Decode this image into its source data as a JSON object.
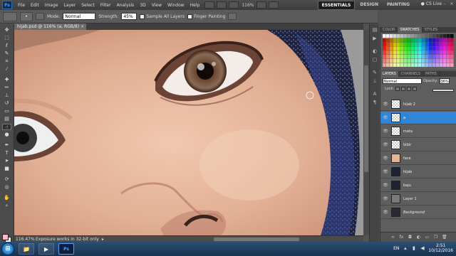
{
  "app": {
    "logo": "Ps"
  },
  "menu": [
    "File",
    "Edit",
    "Image",
    "Layer",
    "Select",
    "Filter",
    "Analysis",
    "3D",
    "View",
    "Window",
    "Help"
  ],
  "zoom_menu": "116%",
  "workspaces": [
    {
      "label": "ESSENTIALS",
      "active": true
    },
    {
      "label": "DESIGN",
      "active": false
    },
    {
      "label": "PAINTING",
      "active": false
    }
  ],
  "cslive": "CS Live",
  "options": {
    "mode_label": "Mode:",
    "mode_value": "Normal",
    "strength_label": "Strength:",
    "strength_value": "45%",
    "sample_all_layers": "Sample All Layers",
    "finger_painting": "Finger Painting"
  },
  "document": {
    "tab_title": "hijab.psd @ 116% (a, RGB/8)",
    "zoom": "116.47%",
    "status": "Exposure works in 32-bit only"
  },
  "swatches": {
    "tabs": [
      {
        "label": "COLOR",
        "active": false
      },
      {
        "label": "SWATCHES",
        "active": true
      },
      {
        "label": "STYLES",
        "active": false
      }
    ]
  },
  "layers_panel": {
    "tabs": [
      {
        "label": "LAYERS",
        "active": true
      },
      {
        "label": "CHANNELS",
        "active": false
      },
      {
        "label": "PATHS",
        "active": false
      }
    ],
    "blend_mode": "Normal",
    "opacity_label": "Opacity:",
    "opacity_value": "36%",
    "lock_label": "Lock:",
    "layers": [
      {
        "name": "hijab 2",
        "thumb": "checker",
        "selected": false,
        "italic": false
      },
      {
        "name": "a",
        "thumb": "checker",
        "selected": true,
        "italic": false
      },
      {
        "name": "mata",
        "thumb": "checker",
        "selected": false,
        "italic": false
      },
      {
        "name": "bibir",
        "thumb": "checker",
        "selected": false,
        "italic": false
      },
      {
        "name": "face",
        "thumb": "face",
        "selected": false,
        "italic": false
      },
      {
        "name": "hijab",
        "thumb": "dark",
        "selected": false,
        "italic": false
      },
      {
        "name": "baju",
        "thumb": "dark",
        "selected": false,
        "italic": false
      },
      {
        "name": "Layer 1",
        "thumb": "gray",
        "selected": false,
        "italic": false
      },
      {
        "name": "Background",
        "thumb": "photo",
        "selected": false,
        "italic": true
      }
    ]
  },
  "taskbar": {
    "lang": "EN",
    "time": "2:51",
    "date": "10/12/2016"
  }
}
